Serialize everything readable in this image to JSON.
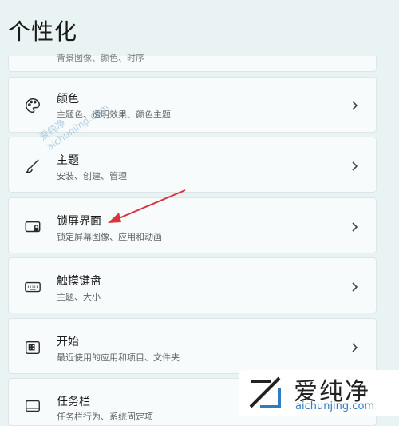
{
  "page": {
    "title": "个性化"
  },
  "items": [
    {
      "title": "",
      "subtitle": "背景图像、颜色、时序",
      "icon": "image-icon"
    },
    {
      "title": "颜色",
      "subtitle": "主题色、透明效果、颜色主题",
      "icon": "palette-icon"
    },
    {
      "title": "主题",
      "subtitle": "安装、创建、管理",
      "icon": "brush-icon"
    },
    {
      "title": "锁屏界面",
      "subtitle": "锁定屏幕图像、应用和动画",
      "icon": "lock-screen-icon"
    },
    {
      "title": "触摸键盘",
      "subtitle": "主题、大小",
      "icon": "keyboard-icon"
    },
    {
      "title": "开始",
      "subtitle": "最近使用的应用和项目、文件夹",
      "icon": "start-icon"
    },
    {
      "title": "任务栏",
      "subtitle": "任务栏行为、系统固定项",
      "icon": "taskbar-icon"
    }
  ],
  "annotation": {
    "color": "#d9333f"
  },
  "watermark": {
    "chinese": "爱纯净",
    "url": "aichunjing.com",
    "faint": "爱纯净 aichunjing.com"
  }
}
